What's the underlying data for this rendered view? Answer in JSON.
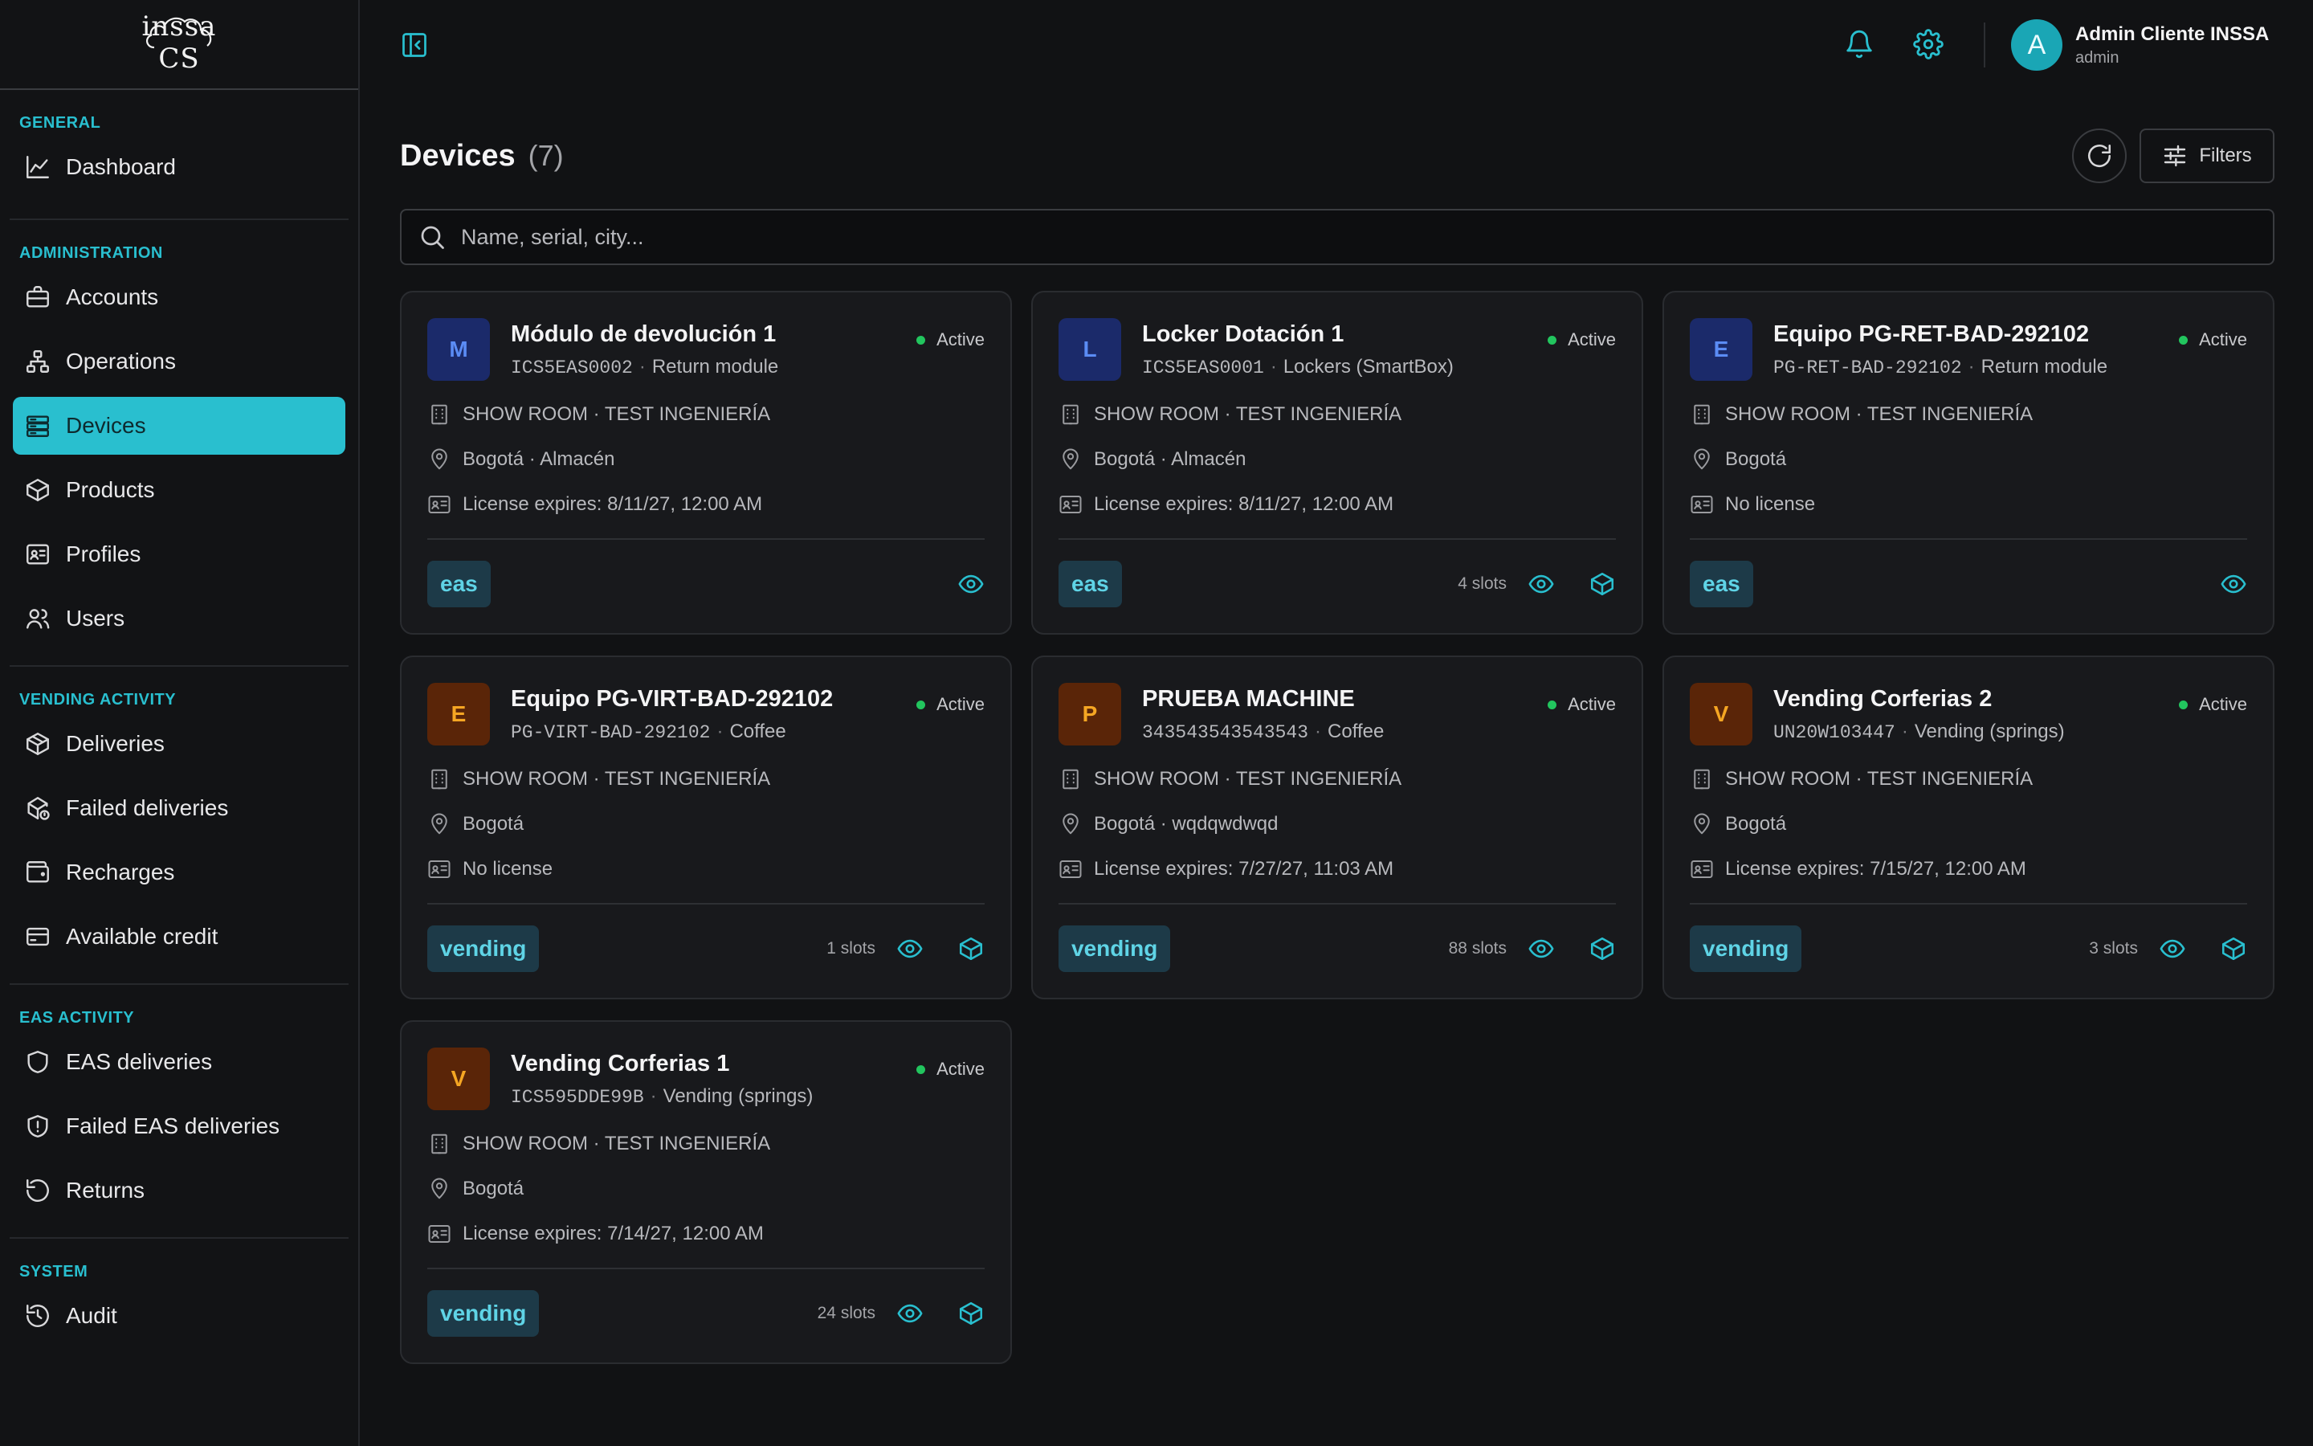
{
  "app": {
    "logo_text": "inssa CS"
  },
  "sidebar": {
    "sections": [
      {
        "heading": "GENERAL",
        "items": [
          {
            "label": "Dashboard",
            "icon": "chart-line-icon"
          }
        ]
      },
      {
        "heading": "ADMINISTRATION",
        "items": [
          {
            "label": "Accounts",
            "icon": "briefcase-icon"
          },
          {
            "label": "Operations",
            "icon": "sitemap-icon"
          },
          {
            "label": "Devices",
            "icon": "server-icon",
            "active": true
          },
          {
            "label": "Products",
            "icon": "box-icon"
          },
          {
            "label": "Profiles",
            "icon": "id-card-icon"
          },
          {
            "label": "Users",
            "icon": "users-icon"
          }
        ]
      },
      {
        "heading": "VENDING ACTIVITY",
        "items": [
          {
            "label": "Deliveries",
            "icon": "package-icon"
          },
          {
            "label": "Failed deliveries",
            "icon": "package-alert-icon"
          },
          {
            "label": "Recharges",
            "icon": "wallet-icon"
          },
          {
            "label": "Available credit",
            "icon": "credit-card-icon"
          }
        ]
      },
      {
        "heading": "EAS ACTIVITY",
        "items": [
          {
            "label": "EAS deliveries",
            "icon": "shield-icon"
          },
          {
            "label": "Failed EAS deliveries",
            "icon": "shield-alert-icon"
          },
          {
            "label": "Returns",
            "icon": "undo-icon"
          }
        ]
      },
      {
        "heading": "SYSTEM",
        "items": [
          {
            "label": "Audit",
            "icon": "history-icon"
          }
        ]
      }
    ]
  },
  "topbar": {
    "user": {
      "initial": "A",
      "name": "Admin Cliente INSSA",
      "role": "admin"
    }
  },
  "page": {
    "title": "Devices",
    "count": "(7)",
    "filters_label": "Filters",
    "search_placeholder": "Name, serial, city..."
  },
  "colors": {
    "accent": "#29bfcf",
    "active_status": "#22c55e",
    "bg": "#111214",
    "card": "#18191c"
  },
  "devices": [
    {
      "initial": "M",
      "color": "blue",
      "name": "Módulo de devolución 1",
      "serial": "ICS5EAS0002",
      "type": "Return module",
      "status": "Active",
      "location": "SHOW ROOM · TEST INGENIERÍA",
      "city": "Bogotá · Almacén",
      "license": "License expires: 8/11/27, 12:00 AM",
      "tag": "eas",
      "slots": "",
      "show_box": false
    },
    {
      "initial": "L",
      "color": "blue",
      "name": "Locker Dotación 1",
      "serial": "ICS5EAS0001",
      "type": "Lockers (SmartBox)",
      "status": "Active",
      "location": "SHOW ROOM · TEST INGENIERÍA",
      "city": "Bogotá · Almacén",
      "license": "License expires: 8/11/27, 12:00 AM",
      "tag": "eas",
      "slots": "4 slots",
      "show_box": true
    },
    {
      "initial": "E",
      "color": "blue",
      "name": "Equipo PG-RET-BAD-292102",
      "serial": "PG-RET-BAD-292102",
      "type": "Return module",
      "status": "Active",
      "location": "SHOW ROOM · TEST INGENIERÍA",
      "city": "Bogotá",
      "license": "No license",
      "tag": "eas",
      "slots": "",
      "show_box": false
    },
    {
      "initial": "E",
      "color": "brown",
      "name": "Equipo PG-VIRT-BAD-292102",
      "serial": "PG-VIRT-BAD-292102",
      "type": "Coffee",
      "status": "Active",
      "location": "SHOW ROOM · TEST INGENIERÍA",
      "city": "Bogotá",
      "license": "No license",
      "tag": "vending",
      "slots": "1 slots",
      "show_box": true
    },
    {
      "initial": "P",
      "color": "brown",
      "name": "PRUEBA MACHINE",
      "serial": "343543543543543",
      "type": "Coffee",
      "status": "Active",
      "location": "SHOW ROOM · TEST INGENIERÍA",
      "city": "Bogotá · wqdqwdwqd",
      "license": "License expires: 7/27/27, 11:03 AM",
      "tag": "vending",
      "slots": "88 slots",
      "show_box": true
    },
    {
      "initial": "V",
      "color": "brown",
      "name": "Vending Corferias 2",
      "serial": "UN20W103447",
      "type": "Vending (springs)",
      "status": "Active",
      "location": "SHOW ROOM · TEST INGENIERÍA",
      "city": "Bogotá",
      "license": "License expires: 7/15/27, 12:00 AM",
      "tag": "vending",
      "slots": "3 slots",
      "show_box": true
    },
    {
      "initial": "V",
      "color": "brown",
      "name": "Vending Corferias 1",
      "serial": "ICS595DDE99B",
      "type": "Vending (springs)",
      "status": "Active",
      "location": "SHOW ROOM · TEST INGENIERÍA",
      "city": "Bogotá",
      "license": "License expires: 7/14/27, 12:00 AM",
      "tag": "vending",
      "slots": "24 slots",
      "show_box": true
    }
  ]
}
